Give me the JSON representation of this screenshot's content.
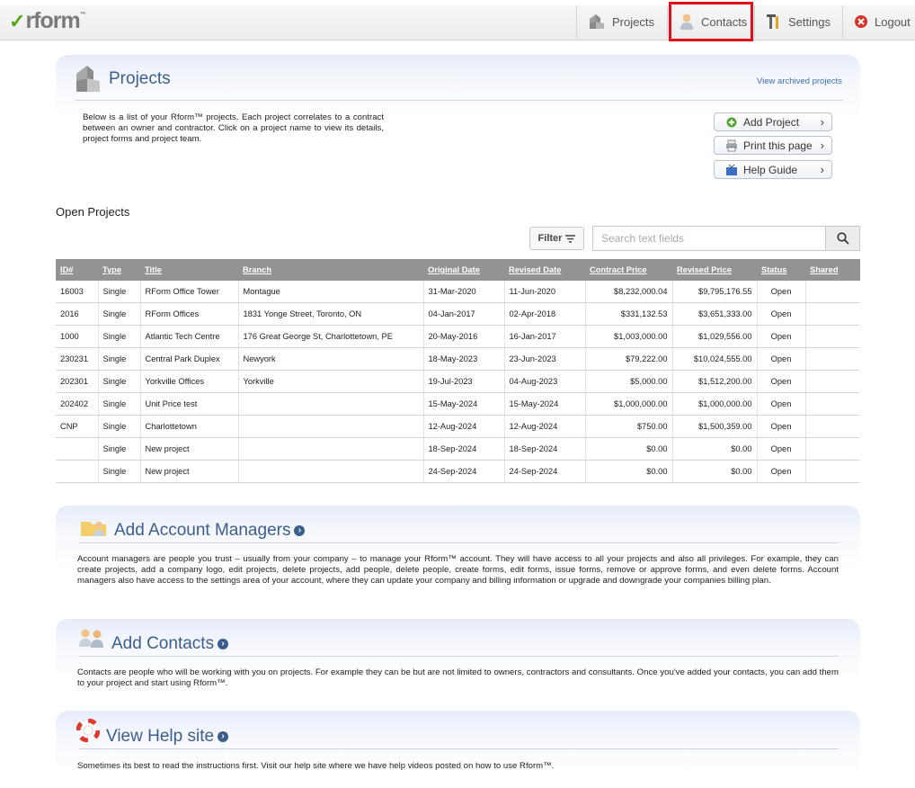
{
  "app": {
    "logo_text": "rform",
    "logo_tm": "™"
  },
  "nav": {
    "projects": "Projects",
    "contacts": "Contacts",
    "settings": "Settings",
    "logout": "Logout"
  },
  "projects_panel": {
    "title": "Projects",
    "view_archived": "View archived projects",
    "description": "Below is a list of your Rform™ projects. Each project correlates to a contract between an owner and contractor. Click on a project name to view its details, project forms and project team.",
    "actions": {
      "add_project": "Add Project",
      "print_page": "Print this page",
      "help_guide": "Help Guide"
    }
  },
  "open_projects": {
    "heading": "Open Projects",
    "filter_label": "Filter",
    "search_placeholder": "Search text fields",
    "columns": [
      "ID#",
      "Type",
      "Title",
      "Branch",
      "Original Date",
      "Revised Date",
      "Contract Price",
      "Revised Price",
      "Status",
      "Shared"
    ],
    "rows": [
      {
        "id": "16003",
        "type": "Single",
        "title": "RForm Office Tower",
        "branch": "Montague",
        "original_date": "31-Mar-2020",
        "revised_date": "11-Jun-2020",
        "contract_price": "$8,232,000.04",
        "revised_price": "$9,795,176.55",
        "status": "Open",
        "shared": ""
      },
      {
        "id": "2016",
        "type": "Single",
        "title": "RForm Offices",
        "branch": "1831 Yonge Street, Toronto, ON",
        "original_date": "04-Jan-2017",
        "revised_date": "02-Apr-2018",
        "contract_price": "$331,132.53",
        "revised_price": "$3,651,333.00",
        "status": "Open",
        "shared": ""
      },
      {
        "id": "1000",
        "type": "Single",
        "title": "Atlantic Tech Centre",
        "branch": "176 Great George St, Charlottetown, PE",
        "original_date": "20-May-2016",
        "revised_date": "16-Jan-2017",
        "contract_price": "$1,003,000.00",
        "revised_price": "$1,029,556.00",
        "status": "Open",
        "shared": ""
      },
      {
        "id": "230231",
        "type": "Single",
        "title": "Central Park Duplex",
        "branch": "Newyork",
        "original_date": "18-May-2023",
        "revised_date": "23-Jun-2023",
        "contract_price": "$79,222.00",
        "revised_price": "$10,024,555.00",
        "status": "Open",
        "shared": ""
      },
      {
        "id": "202301",
        "type": "Single",
        "title": "Yorkville Offices",
        "branch": "Yorkville",
        "original_date": "19-Jul-2023",
        "revised_date": "04-Aug-2023",
        "contract_price": "$5,000.00",
        "revised_price": "$1,512,200.00",
        "status": "Open",
        "shared": ""
      },
      {
        "id": "202402",
        "type": "Single",
        "title": "Unit Price test",
        "branch": "",
        "original_date": "15-May-2024",
        "revised_date": "15-May-2024",
        "contract_price": "$1,000,000.00",
        "revised_price": "$1,000,000.00",
        "status": "Open",
        "shared": ""
      },
      {
        "id": "CNP",
        "type": "Single",
        "title": "Charlottetown",
        "branch": "",
        "original_date": "12-Aug-2024",
        "revised_date": "12-Aug-2024",
        "contract_price": "$750.00",
        "revised_price": "$1,500,359.00",
        "status": "Open",
        "shared": ""
      },
      {
        "id": "",
        "type": "Single",
        "title": "New project",
        "branch": "",
        "original_date": "18-Sep-2024",
        "revised_date": "18-Sep-2024",
        "contract_price": "$0.00",
        "revised_price": "$0.00",
        "status": "Open",
        "shared": ""
      },
      {
        "id": "",
        "type": "Single",
        "title": "New project",
        "branch": "",
        "original_date": "24-Sep-2024",
        "revised_date": "24-Sep-2024",
        "contract_price": "$0.00",
        "revised_price": "$0.00",
        "status": "Open",
        "shared": ""
      }
    ]
  },
  "account_managers": {
    "title": "Add Account Managers",
    "description": "Account managers are people you trust – usually from your company – to manage your Rform™ account. They will have access to all your projects and also all privileges. For example, they can create projects, add a company logo, edit projects, delete projects, add people, delete people, create forms, edit forms, issue forms, remove or approve forms, and even delete forms. Account managers also have access to the settings area of your account, where they can update your company and billing information or upgrade and downgrade your companies billing plan."
  },
  "contacts": {
    "title": "Add Contacts",
    "description": "Contacts are people who will be working with you on projects. For example they can be but are not limited to owners, contractors and consultants. Once you've added your contacts, you can add them to your project and start using Rform™."
  },
  "help_site": {
    "title": "View Help site",
    "description": "Sometimes its best to read the instructions first. Visit our help site where we have help videos posted on how to use Rform™."
  },
  "colors": {
    "accent": "#3a5f8c",
    "highlight": "#e0101c",
    "header_gray": "#939393",
    "logo_green": "#58a618"
  }
}
